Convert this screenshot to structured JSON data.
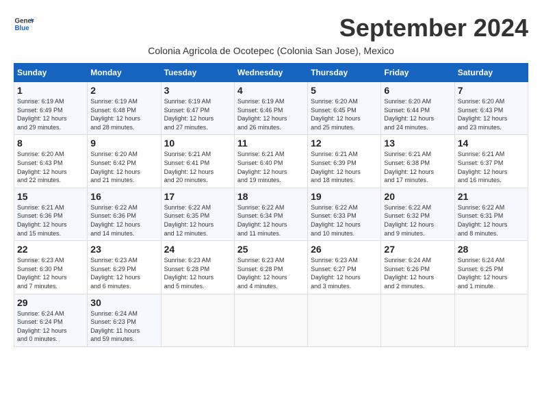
{
  "header": {
    "logo_line1": "General",
    "logo_line2": "Blue",
    "month": "September 2024",
    "subtitle": "Colonia Agricola de Ocotepec (Colonia San Jose), Mexico"
  },
  "days_of_week": [
    "Sunday",
    "Monday",
    "Tuesday",
    "Wednesday",
    "Thursday",
    "Friday",
    "Saturday"
  ],
  "weeks": [
    [
      {
        "day": "1",
        "rise": "6:19 AM",
        "set": "6:49 PM",
        "hours": "12 hours",
        "mins": "29 minutes"
      },
      {
        "day": "2",
        "rise": "6:19 AM",
        "set": "6:48 PM",
        "hours": "12 hours",
        "mins": "28 minutes"
      },
      {
        "day": "3",
        "rise": "6:19 AM",
        "set": "6:47 PM",
        "hours": "12 hours",
        "mins": "27 minutes"
      },
      {
        "day": "4",
        "rise": "6:19 AM",
        "set": "6:46 PM",
        "hours": "12 hours",
        "mins": "26 minutes"
      },
      {
        "day": "5",
        "rise": "6:20 AM",
        "set": "6:45 PM",
        "hours": "12 hours",
        "mins": "25 minutes"
      },
      {
        "day": "6",
        "rise": "6:20 AM",
        "set": "6:44 PM",
        "hours": "12 hours",
        "mins": "24 minutes"
      },
      {
        "day": "7",
        "rise": "6:20 AM",
        "set": "6:43 PM",
        "hours": "12 hours",
        "mins": "23 minutes"
      }
    ],
    [
      {
        "day": "8",
        "rise": "6:20 AM",
        "set": "6:43 PM",
        "hours": "12 hours",
        "mins": "22 minutes"
      },
      {
        "day": "9",
        "rise": "6:20 AM",
        "set": "6:42 PM",
        "hours": "12 hours",
        "mins": "21 minutes"
      },
      {
        "day": "10",
        "rise": "6:21 AM",
        "set": "6:41 PM",
        "hours": "12 hours",
        "mins": "20 minutes"
      },
      {
        "day": "11",
        "rise": "6:21 AM",
        "set": "6:40 PM",
        "hours": "12 hours",
        "mins": "19 minutes"
      },
      {
        "day": "12",
        "rise": "6:21 AM",
        "set": "6:39 PM",
        "hours": "12 hours",
        "mins": "18 minutes"
      },
      {
        "day": "13",
        "rise": "6:21 AM",
        "set": "6:38 PM",
        "hours": "12 hours",
        "mins": "17 minutes"
      },
      {
        "day": "14",
        "rise": "6:21 AM",
        "set": "6:37 PM",
        "hours": "12 hours",
        "mins": "16 minutes"
      }
    ],
    [
      {
        "day": "15",
        "rise": "6:21 AM",
        "set": "6:36 PM",
        "hours": "12 hours",
        "mins": "15 minutes"
      },
      {
        "day": "16",
        "rise": "6:22 AM",
        "set": "6:36 PM",
        "hours": "12 hours",
        "mins": "14 minutes"
      },
      {
        "day": "17",
        "rise": "6:22 AM",
        "set": "6:35 PM",
        "hours": "12 hours",
        "mins": "12 minutes"
      },
      {
        "day": "18",
        "rise": "6:22 AM",
        "set": "6:34 PM",
        "hours": "12 hours",
        "mins": "11 minutes"
      },
      {
        "day": "19",
        "rise": "6:22 AM",
        "set": "6:33 PM",
        "hours": "12 hours",
        "mins": "10 minutes"
      },
      {
        "day": "20",
        "rise": "6:22 AM",
        "set": "6:32 PM",
        "hours": "12 hours",
        "mins": "9 minutes"
      },
      {
        "day": "21",
        "rise": "6:22 AM",
        "set": "6:31 PM",
        "hours": "12 hours",
        "mins": "8 minutes"
      }
    ],
    [
      {
        "day": "22",
        "rise": "6:23 AM",
        "set": "6:30 PM",
        "hours": "12 hours",
        "mins": "7 minutes"
      },
      {
        "day": "23",
        "rise": "6:23 AM",
        "set": "6:29 PM",
        "hours": "12 hours",
        "mins": "6 minutes"
      },
      {
        "day": "24",
        "rise": "6:23 AM",
        "set": "6:28 PM",
        "hours": "12 hours",
        "mins": "5 minutes"
      },
      {
        "day": "25",
        "rise": "6:23 AM",
        "set": "6:28 PM",
        "hours": "12 hours",
        "mins": "4 minutes"
      },
      {
        "day": "26",
        "rise": "6:23 AM",
        "set": "6:27 PM",
        "hours": "12 hours",
        "mins": "3 minutes"
      },
      {
        "day": "27",
        "rise": "6:24 AM",
        "set": "6:26 PM",
        "hours": "12 hours",
        "mins": "2 minutes"
      },
      {
        "day": "28",
        "rise": "6:24 AM",
        "set": "6:25 PM",
        "hours": "12 hours",
        "mins": "1 minute"
      }
    ],
    [
      {
        "day": "29",
        "rise": "6:24 AM",
        "set": "6:24 PM",
        "hours": "12 hours",
        "mins": "0 minutes"
      },
      {
        "day": "30",
        "rise": "6:24 AM",
        "set": "6:23 PM",
        "hours": "11 hours",
        "mins": "59 minutes"
      },
      null,
      null,
      null,
      null,
      null
    ]
  ]
}
